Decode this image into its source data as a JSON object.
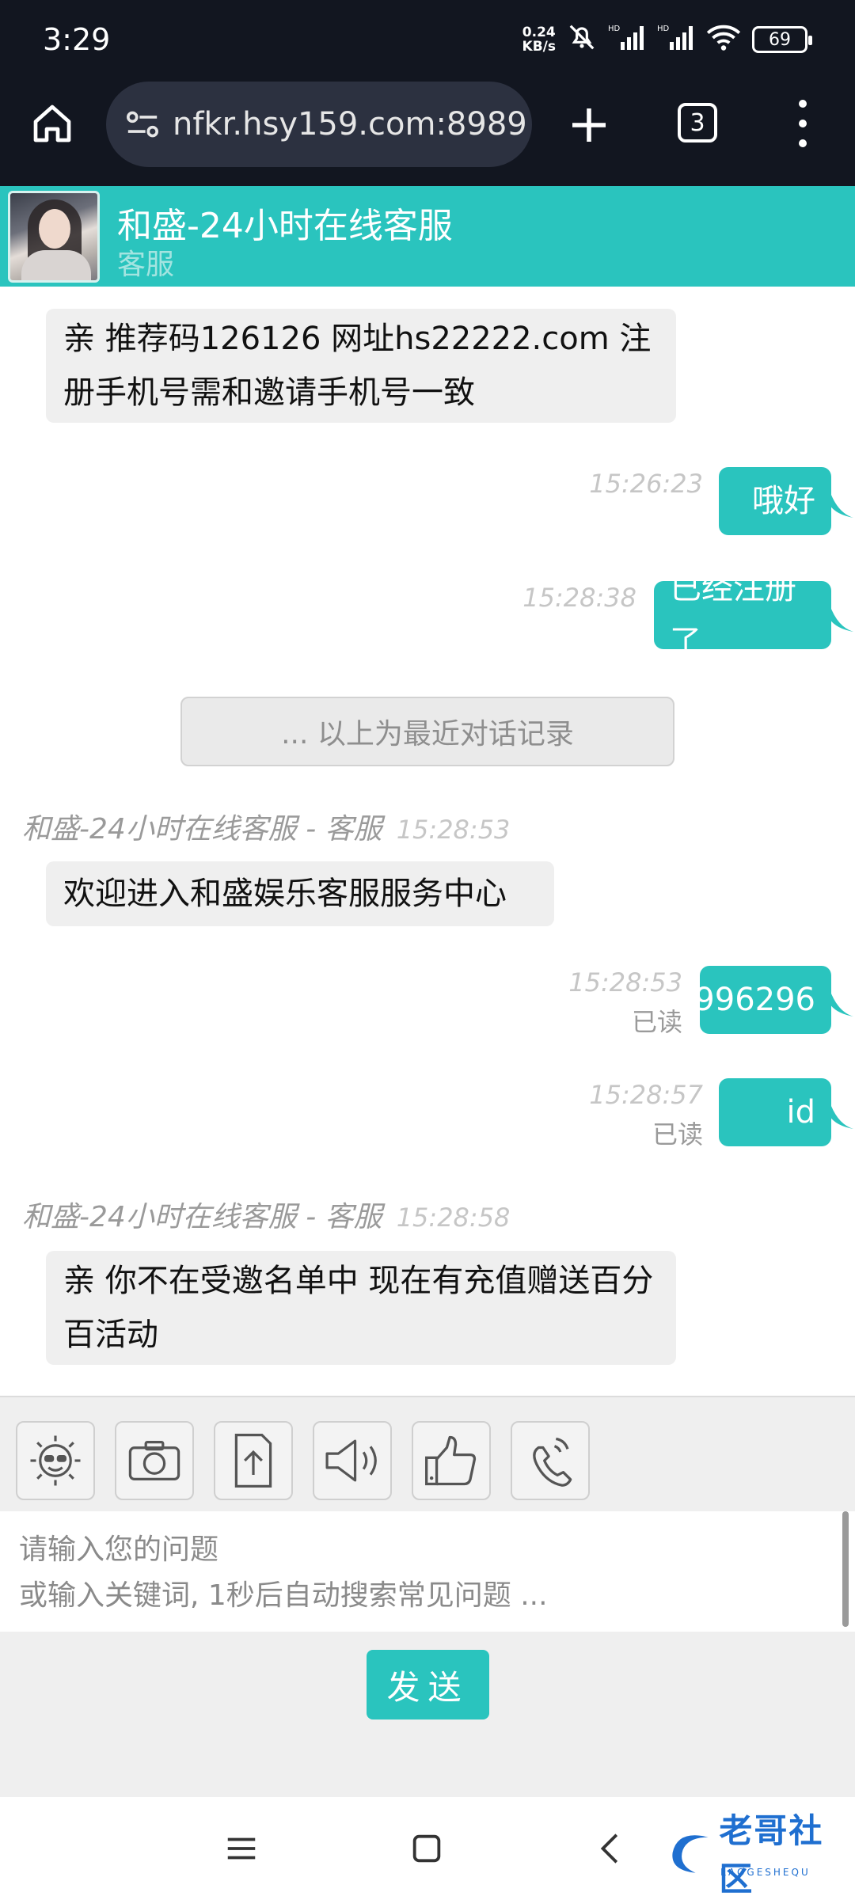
{
  "status_bar": {
    "time": "3:29",
    "net_speed_value": "0.24",
    "net_speed_unit": "KB/s",
    "signal_labels": [
      "HD",
      "HD"
    ],
    "battery": "69"
  },
  "browser": {
    "url": "nfkr.hsy159.com:8989",
    "tab_count": "3"
  },
  "chat": {
    "title": "和盛-24小时在线客服",
    "subtitle": "客服",
    "divider_text": "... 以上为最近对话记录",
    "messages": [
      {
        "side": "left",
        "text": "亲 推荐码126126 网址hs22222.com 注册手机号需和邀请手机号一致"
      },
      {
        "side": "right",
        "text": "哦好",
        "time": "15:26:23"
      },
      {
        "side": "right",
        "text": "已经注册了",
        "time": "15:28:38"
      },
      {
        "side": "left",
        "sender": "和盛-24小时在线客服 - 客服",
        "time": "15:28:53",
        "text": "欢迎进入和盛娱乐客服服务中心"
      },
      {
        "side": "right",
        "text": "996296",
        "time": "15:28:53",
        "status": "已读"
      },
      {
        "side": "right",
        "text": "id",
        "time": "15:28:57",
        "status": "已读"
      },
      {
        "side": "left",
        "sender": "和盛-24小时在线客服 - 客服",
        "time": "15:28:58",
        "text": "亲 你不在受邀名单中 现在有充值赠送百分百活动"
      }
    ]
  },
  "toolbar": {
    "tools": [
      "emoji-icon",
      "camera-icon",
      "upload-icon",
      "speaker-icon",
      "thumbs-up-icon",
      "phone-icon"
    ]
  },
  "composer": {
    "placeholder": "请输入您的问题\n或输入关键词, 1秒后自动搜索常见问题 ...",
    "send_label": "发送"
  },
  "watermark": {
    "text": "老哥社区",
    "sub": "LAOGESHEQU"
  },
  "colors": {
    "accent": "#2ac4be",
    "chrome": "#121620"
  }
}
